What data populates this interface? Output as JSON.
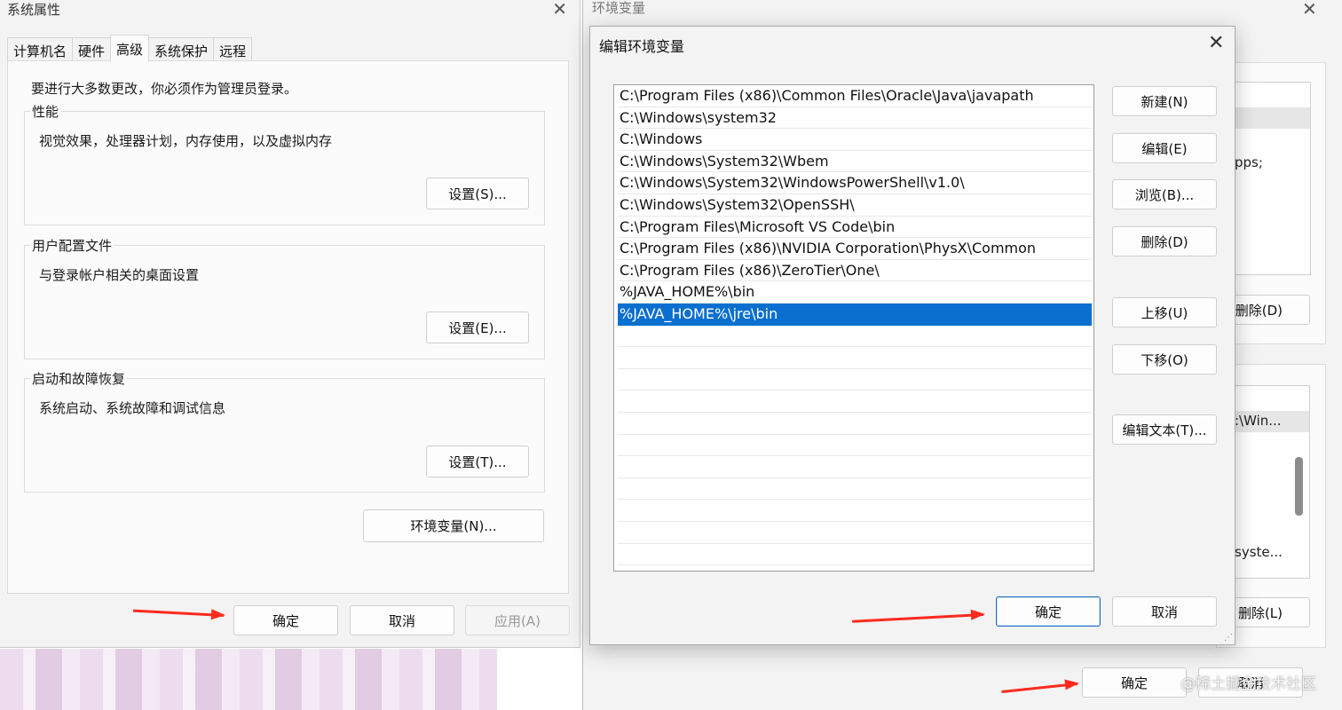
{
  "system_properties": {
    "title": "系统属性",
    "tabs": [
      "计算机名",
      "硬件",
      "高级",
      "系统保护",
      "远程"
    ],
    "admin_note": "要进行大多数更改，你必须作为管理员登录。",
    "performance": {
      "title": "性能",
      "desc": "视觉效果，处理器计划，内存使用，以及虚拟内存",
      "button": "设置(S)..."
    },
    "user_profiles": {
      "title": "用户配置文件",
      "desc": "与登录帐户相关的桌面设置",
      "button": "设置(E)..."
    },
    "startup_recovery": {
      "title": "启动和故障恢复",
      "desc": "系统启动、系统故障和调试信息",
      "button": "设置(T)..."
    },
    "env_button": "环境变量(N)...",
    "ok": "确定",
    "cancel": "取消",
    "apply": "应用(A)"
  },
  "environment_variables": {
    "title": "环境变量",
    "fragments": {
      "apps": "pps;",
      "win": ":\\Win...",
      "syste": "syste..."
    },
    "delete_top": "删除(D)",
    "delete_bottom": "删除(L)",
    "ok": "确定",
    "cancel": "取消"
  },
  "edit_dialog": {
    "title": "编辑环境变量",
    "paths": [
      "C:\\Program Files (x86)\\Common Files\\Oracle\\Java\\javapath",
      "C:\\Windows\\system32",
      "C:\\Windows",
      "C:\\Windows\\System32\\Wbem",
      "C:\\Windows\\System32\\WindowsPowerShell\\v1.0\\",
      "C:\\Windows\\System32\\OpenSSH\\",
      "C:\\Program Files\\Microsoft VS Code\\bin",
      "C:\\Program Files (x86)\\NVIDIA Corporation\\PhysX\\Common",
      "C:\\Program Files (x86)\\ZeroTier\\One\\",
      "%JAVA_HOME%\\bin",
      "%JAVA_HOME%\\jre\\bin"
    ],
    "selected_index": 10,
    "buttons": {
      "new": "新建(N)",
      "edit": "编辑(E)",
      "browse": "浏览(B)...",
      "delete": "删除(D)",
      "move_up": "上移(U)",
      "move_down": "下移(O)",
      "edit_text": "编辑文本(T)..."
    },
    "ok": "确定",
    "cancel": "取消"
  },
  "watermark": "@稀土掘金技术社区",
  "colors": {
    "selection": "#0a6fcf",
    "arrow": "#ff2a1e",
    "window_bg": "#f3f3f3"
  }
}
